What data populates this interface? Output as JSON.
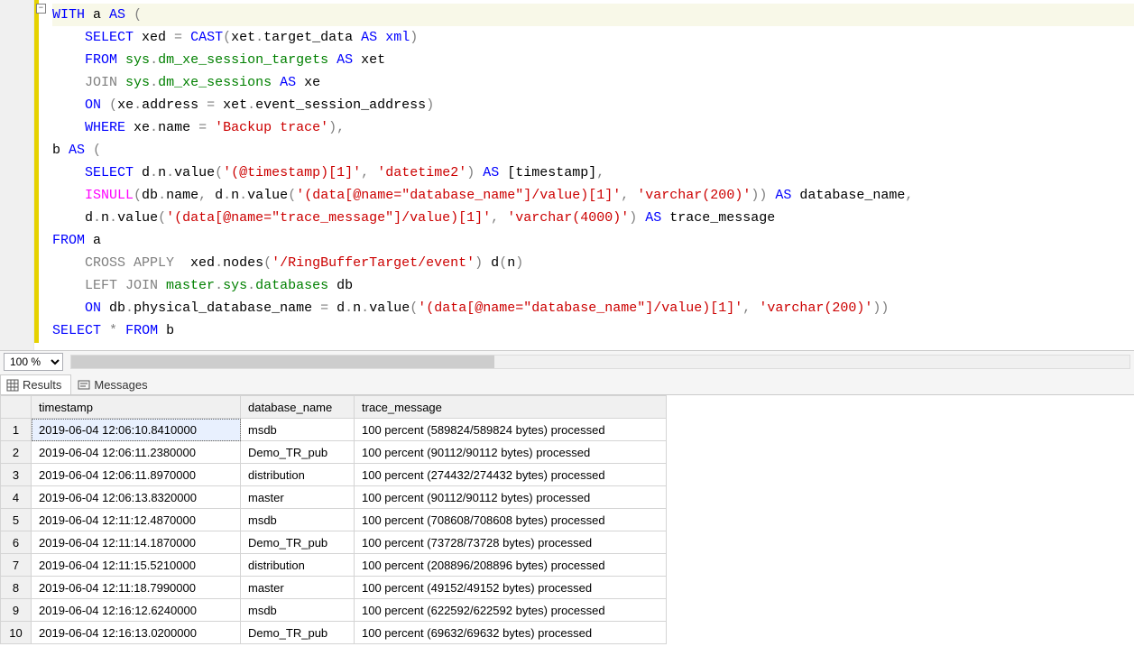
{
  "zoom": "100 %",
  "code_lines": [
    {
      "cls": "current-line",
      "html": "<span class='kw-blue'>WITH</span> a <span class='kw-blue'>AS</span> <span class='kw-gray'>(</span>"
    },
    {
      "cls": "",
      "html": "    <span class='kw-blue'>SELECT</span> xed <span class='kw-gray'>=</span> <span class='kw-blue'>CAST</span><span class='kw-gray'>(</span>xet<span class='kw-gray'>.</span>target_data <span class='kw-blue'>AS</span> <span class='kw-blue'>xml</span><span class='kw-gray'>)</span>"
    },
    {
      "cls": "",
      "html": "    <span class='kw-blue'>FROM</span> <span class='kw-green'>sys</span><span class='kw-gray'>.</span><span class='kw-green'>dm_xe_session_targets</span> <span class='kw-blue'>AS</span> xet"
    },
    {
      "cls": "",
      "html": "    <span class='kw-gray'>JOIN</span> <span class='kw-green'>sys</span><span class='kw-gray'>.</span><span class='kw-green'>dm_xe_sessions</span> <span class='kw-blue'>AS</span> xe"
    },
    {
      "cls": "",
      "html": "    <span class='kw-blue'>ON</span> <span class='kw-gray'>(</span>xe<span class='kw-gray'>.</span>address <span class='kw-gray'>=</span> xet<span class='kw-gray'>.</span>event_session_address<span class='kw-gray'>)</span>"
    },
    {
      "cls": "",
      "html": "    <span class='kw-blue'>WHERE</span> xe<span class='kw-gray'>.</span>name <span class='kw-gray'>=</span> <span class='kw-str'>'Backup trace'</span><span class='kw-gray'>),</span>"
    },
    {
      "cls": "",
      "html": "b <span class='kw-blue'>AS</span> <span class='kw-gray'>(</span>"
    },
    {
      "cls": "",
      "html": "    <span class='kw-blue'>SELECT</span> d<span class='kw-gray'>.</span>n<span class='kw-gray'>.</span><span class='kw-func'>value</span><span class='kw-gray'>(</span><span class='kw-str'>'(@timestamp)[1]'</span><span class='kw-gray'>,</span> <span class='kw-str'>'datetime2'</span><span class='kw-gray'>)</span> <span class='kw-blue'>AS</span> [timestamp]<span class='kw-gray'>,</span>"
    },
    {
      "cls": "",
      "html": "    <span class='kw-pink'>ISNULL</span><span class='kw-gray'>(</span>db<span class='kw-gray'>.</span>name<span class='kw-gray'>,</span> d<span class='kw-gray'>.</span>n<span class='kw-gray'>.</span><span class='kw-func'>value</span><span class='kw-gray'>(</span><span class='kw-str'>'(data[@name=\"database_name\"]/value)[1]'</span><span class='kw-gray'>,</span> <span class='kw-str'>'varchar(200)'</span><span class='kw-gray'>))</span> <span class='kw-blue'>AS</span> database_name<span class='kw-gray'>,</span>"
    },
    {
      "cls": "",
      "html": "    d<span class='kw-gray'>.</span>n<span class='kw-gray'>.</span><span class='kw-func'>value</span><span class='kw-gray'>(</span><span class='kw-str'>'(data[@name=\"trace_message\"]/value)[1]'</span><span class='kw-gray'>,</span> <span class='kw-str'>'varchar(4000)'</span><span class='kw-gray'>)</span> <span class='kw-blue'>AS</span> trace_message"
    },
    {
      "cls": "",
      "html": "<span class='kw-blue'>FROM</span> a"
    },
    {
      "cls": "",
      "html": "    <span class='kw-gray'>CROSS APPLY</span>  xed<span class='kw-gray'>.</span><span class='kw-func'>nodes</span><span class='kw-gray'>(</span><span class='kw-str'>'/RingBufferTarget/event'</span><span class='kw-gray'>)</span> d<span class='kw-gray'>(</span>n<span class='kw-gray'>)</span>"
    },
    {
      "cls": "",
      "html": "    <span class='kw-gray'>LEFT JOIN</span> <span class='kw-green'>master</span><span class='kw-gray'>.</span><span class='kw-green'>sys</span><span class='kw-gray'>.</span><span class='kw-green'>databases</span> db"
    },
    {
      "cls": "",
      "html": "    <span class='kw-blue'>ON</span> db<span class='kw-gray'>.</span>physical_database_name <span class='kw-gray'>=</span> d<span class='kw-gray'>.</span>n<span class='kw-gray'>.</span><span class='kw-func'>value</span><span class='kw-gray'>(</span><span class='kw-str'>'(data[@name=\"database_name\"]/value)[1]'</span><span class='kw-gray'>,</span> <span class='kw-str'>'varchar(200)'</span><span class='kw-gray'>))</span>"
    },
    {
      "cls": "",
      "html": "<span class='kw-blue'>SELECT</span> <span class='kw-gray'>*</span> <span class='kw-blue'>FROM</span> b"
    }
  ],
  "tabs": {
    "results": "Results",
    "messages": "Messages"
  },
  "columns": [
    "timestamp",
    "database_name",
    "trace_message"
  ],
  "rows": [
    {
      "n": "1",
      "ts": "2019-06-04 12:06:10.8410000",
      "db": "msdb",
      "msg": "100 percent (589824/589824 bytes) processed"
    },
    {
      "n": "2",
      "ts": "2019-06-04 12:06:11.2380000",
      "db": "Demo_TR_pub",
      "msg": "100 percent (90112/90112 bytes) processed"
    },
    {
      "n": "3",
      "ts": "2019-06-04 12:06:11.8970000",
      "db": "distribution",
      "msg": "100 percent (274432/274432 bytes) processed"
    },
    {
      "n": "4",
      "ts": "2019-06-04 12:06:13.8320000",
      "db": "master",
      "msg": "100 percent (90112/90112 bytes) processed"
    },
    {
      "n": "5",
      "ts": "2019-06-04 12:11:12.4870000",
      "db": "msdb",
      "msg": "100 percent (708608/708608 bytes) processed"
    },
    {
      "n": "6",
      "ts": "2019-06-04 12:11:14.1870000",
      "db": "Demo_TR_pub",
      "msg": "100 percent (73728/73728 bytes) processed"
    },
    {
      "n": "7",
      "ts": "2019-06-04 12:11:15.5210000",
      "db": "distribution",
      "msg": "100 percent (208896/208896 bytes) processed"
    },
    {
      "n": "8",
      "ts": "2019-06-04 12:11:18.7990000",
      "db": "master",
      "msg": "100 percent (49152/49152 bytes) processed"
    },
    {
      "n": "9",
      "ts": "2019-06-04 12:16:12.6240000",
      "db": "msdb",
      "msg": "100 percent (622592/622592 bytes) processed"
    },
    {
      "n": "10",
      "ts": "2019-06-04 12:16:13.0200000",
      "db": "Demo_TR_pub",
      "msg": "100 percent (69632/69632 bytes) processed"
    }
  ]
}
